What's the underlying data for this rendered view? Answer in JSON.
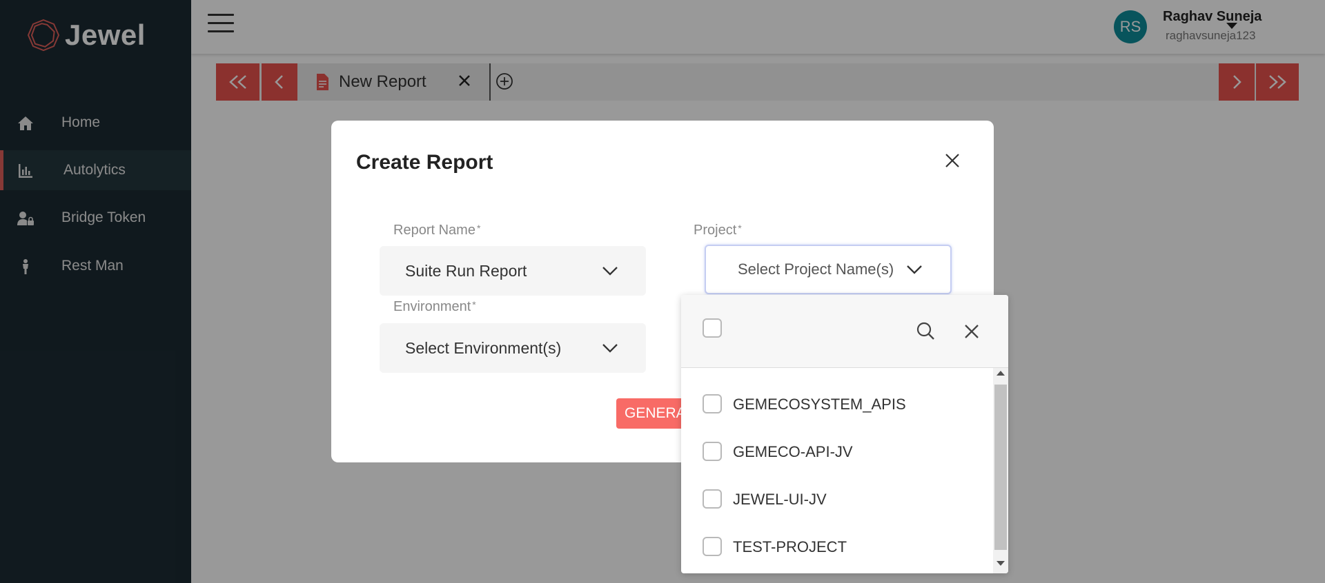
{
  "brand": {
    "name": "Jewel",
    "accent": "#e8534e"
  },
  "sidebar": {
    "items": [
      {
        "label": "Home",
        "icon": "home-icon",
        "active": false
      },
      {
        "label": "Autolytics",
        "icon": "bar-chart-icon",
        "active": true
      },
      {
        "label": "Bridge Token",
        "icon": "user-lock-icon",
        "active": false
      },
      {
        "label": "Rest Man",
        "icon": "person-icon",
        "active": false
      }
    ]
  },
  "header": {
    "user": {
      "initials": "RS",
      "name": "Raghav Suneja",
      "handle": "raghavsuneja123"
    }
  },
  "tabs": {
    "first_label": "<<",
    "prev_label": "<",
    "next_label": ">",
    "last_label": ">>",
    "items": [
      {
        "label": "New Report",
        "icon": "document-icon"
      }
    ]
  },
  "modal": {
    "title": "Create Report",
    "fields": {
      "report_name": {
        "label": "Report Name",
        "value": "Suite Run Report"
      },
      "project": {
        "label": "Project",
        "placeholder": "Select Project Name(s)"
      },
      "environment": {
        "label": "Environment",
        "placeholder": "Select Environment(s)"
      }
    },
    "required_mark": "*",
    "generate_label": "GENERATE"
  },
  "dropdown": {
    "options": [
      "GEMECOSYSTEM_APIS",
      "GEMECO-API-JV",
      "JEWEL-UI-JV",
      "TEST-PROJECT"
    ]
  }
}
